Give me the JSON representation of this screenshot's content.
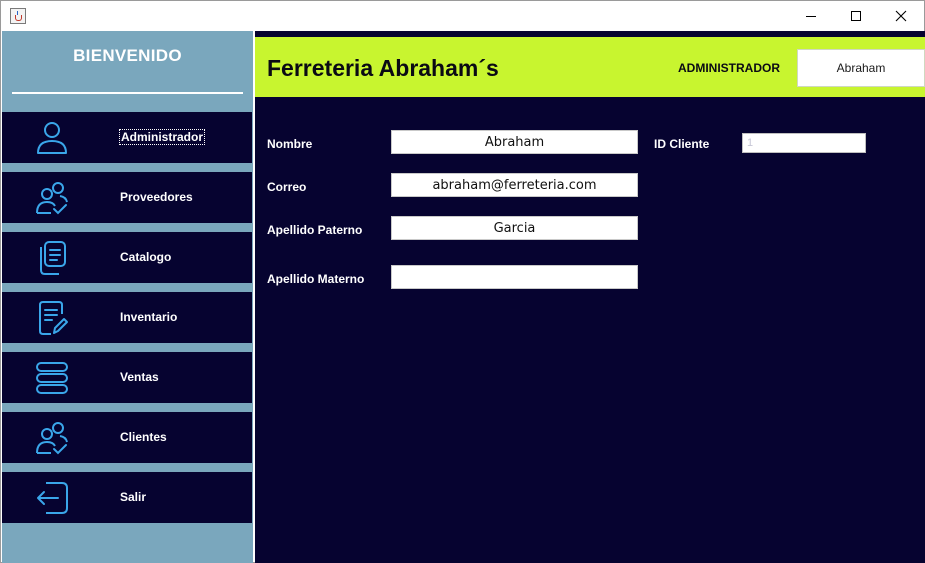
{
  "window": {
    "icons": {
      "app": "java-cup-icon",
      "minimize": "minimize-icon",
      "maximize": "maximize-icon",
      "close": "close-icon"
    },
    "close_glyph": "✕"
  },
  "sidebar": {
    "welcome": "BIENVENIDO",
    "items": [
      {
        "label": "Administrador",
        "icon": "user-icon"
      },
      {
        "label": "Proveedores",
        "icon": "users-check-icon"
      },
      {
        "label": "Catalogo",
        "icon": "copy-document-icon"
      },
      {
        "label": "Inventario",
        "icon": "document-edit-icon"
      },
      {
        "label": "Ventas",
        "icon": "stack-list-icon"
      },
      {
        "label": "Clientes",
        "icon": "users-check-icon"
      },
      {
        "label": "Salir",
        "icon": "logout-icon"
      }
    ]
  },
  "header": {
    "title": "Ferreteria Abraham´s",
    "role": "ADMINISTRADOR",
    "user": "Abraham"
  },
  "form": {
    "nombre": {
      "label": "Nombre",
      "value": "Abraham"
    },
    "correo": {
      "label": "Correo",
      "value": "abraham@ferreteria.com"
    },
    "apellido_paterno": {
      "label": "Apellido Paterno",
      "value": "Garcia"
    },
    "apellido_materno": {
      "label": "Apellido Materno",
      "value": ""
    },
    "id_cliente": {
      "label": "ID Cliente",
      "value": "1"
    }
  },
  "colors": {
    "sidebar_bg": "#7aa7bd",
    "nav_bg": "#060330",
    "main_bg": "#060330",
    "header_accent": "#c8f52f",
    "icon_blue": "#3aa6ea"
  }
}
